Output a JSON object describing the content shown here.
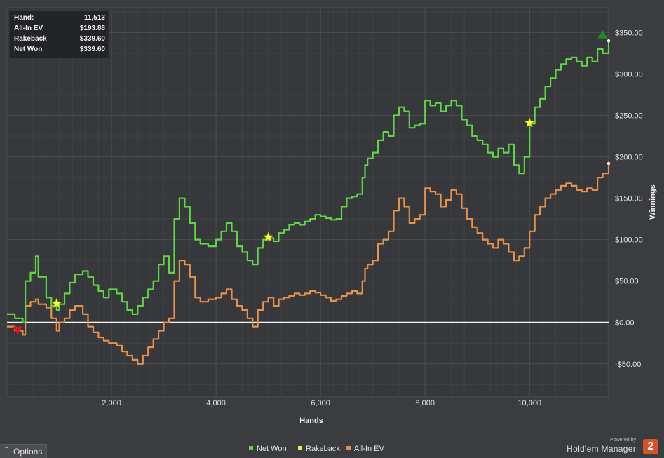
{
  "summary": {
    "rows": [
      {
        "label": "Hand:",
        "value": "11,513"
      },
      {
        "label": "All-In EV",
        "value": "$193.88"
      },
      {
        "label": "Rakeback",
        "value": "$339.60"
      },
      {
        "label": "Net Won",
        "value": "$339.60"
      }
    ]
  },
  "options": {
    "label": "Options",
    "icon": "chevron-up-icon"
  },
  "legend": [
    {
      "label": "Net Won",
      "color": "#5ed645"
    },
    {
      "label": "Rakeback",
      "color": "#ecec3a"
    },
    {
      "label": "All-In EV",
      "color": "#e8914a"
    }
  ],
  "branding": {
    "powered_by": "Powered by",
    "name": "Hold'em Manager",
    "logo_text": "2"
  },
  "chart_data": {
    "type": "line",
    "xlabel": "Hands",
    "ylabel": "Winnings",
    "xlim": [
      0,
      11513
    ],
    "ylim": [
      -90,
      380
    ],
    "x_ticks": [
      2000,
      4000,
      6000,
      8000,
      10000
    ],
    "x_tick_labels": [
      "2,000",
      "4,000",
      "6,000",
      "8,000",
      "10,000"
    ],
    "y_ticks": [
      -50,
      0,
      50,
      100,
      150,
      200,
      250,
      300,
      350
    ],
    "y_tick_labels": [
      "-$50.00",
      "$0.00",
      "$50.00",
      "$100.00",
      "$150.00",
      "$200.00",
      "$250.00",
      "$300.00",
      "$350.00"
    ],
    "grid": true,
    "y_axis_side": "right",
    "series": [
      {
        "name": "Net Won",
        "color": "#5ed645",
        "x": [
          0,
          150,
          300,
          350,
          450,
          550,
          600,
          750,
          850,
          950,
          1000,
          1100,
          1200,
          1300,
          1450,
          1550,
          1650,
          1750,
          1850,
          1950,
          2100,
          2200,
          2300,
          2400,
          2500,
          2600,
          2700,
          2800,
          2900,
          3000,
          3100,
          3200,
          3300,
          3400,
          3500,
          3600,
          3700,
          3850,
          4000,
          4100,
          4200,
          4300,
          4400,
          4500,
          4600,
          4700,
          4800,
          4900,
          5000,
          5100,
          5200,
          5300,
          5400,
          5500,
          5600,
          5700,
          5800,
          5900,
          6000,
          6100,
          6200,
          6300,
          6400,
          6500,
          6600,
          6700,
          6800,
          6850,
          6900,
          7000,
          7100,
          7200,
          7300,
          7400,
          7500,
          7600,
          7700,
          7800,
          7900,
          8000,
          8100,
          8200,
          8300,
          8400,
          8500,
          8600,
          8700,
          8800,
          8900,
          9000,
          9100,
          9200,
          9300,
          9400,
          9500,
          9600,
          9700,
          9800,
          9900,
          10000,
          10100,
          10200,
          10300,
          10400,
          10500,
          10600,
          10700,
          10800,
          10900,
          11000,
          11100,
          11200,
          11300,
          11400,
          11513
        ],
        "y": [
          10,
          5,
          0,
          50,
          60,
          80,
          55,
          30,
          20,
          15,
          22,
          35,
          48,
          58,
          62,
          55,
          45,
          38,
          30,
          40,
          35,
          25,
          15,
          10,
          20,
          30,
          40,
          50,
          70,
          80,
          60,
          125,
          150,
          140,
          120,
          100,
          95,
          92,
          100,
          110,
          120,
          110,
          92,
          85,
          75,
          70,
          90,
          100,
          102,
          98,
          108,
          112,
          118,
          120,
          118,
          122,
          125,
          130,
          128,
          126,
          124,
          125,
          140,
          150,
          152,
          155,
          175,
          190,
          198,
          205,
          220,
          230,
          225,
          250,
          260,
          255,
          235,
          238,
          240,
          268,
          262,
          265,
          255,
          262,
          268,
          262,
          245,
          238,
          225,
          220,
          215,
          205,
          200,
          210,
          205,
          215,
          190,
          180,
          200,
          240,
          260,
          270,
          285,
          295,
          305,
          312,
          318,
          320,
          315,
          310,
          320,
          315,
          330,
          325,
          340
        ]
      },
      {
        "name": "All-In EV",
        "color": "#e8914a",
        "x": [
          0,
          150,
          300,
          350,
          450,
          550,
          600,
          750,
          850,
          950,
          1000,
          1100,
          1200,
          1300,
          1450,
          1550,
          1650,
          1750,
          1850,
          1950,
          2100,
          2200,
          2300,
          2400,
          2500,
          2600,
          2700,
          2800,
          2900,
          3000,
          3100,
          3200,
          3300,
          3400,
          3500,
          3600,
          3700,
          3850,
          4000,
          4100,
          4200,
          4300,
          4400,
          4500,
          4600,
          4700,
          4800,
          4900,
          5000,
          5100,
          5200,
          5300,
          5400,
          5500,
          5600,
          5700,
          5800,
          5900,
          6000,
          6100,
          6200,
          6300,
          6400,
          6500,
          6600,
          6700,
          6800,
          6850,
          6900,
          7000,
          7100,
          7200,
          7300,
          7400,
          7500,
          7600,
          7700,
          7800,
          7900,
          8000,
          8100,
          8200,
          8300,
          8400,
          8500,
          8600,
          8700,
          8800,
          8900,
          9000,
          9100,
          9200,
          9300,
          9400,
          9500,
          9600,
          9700,
          9800,
          9900,
          10000,
          10100,
          10200,
          10300,
          10400,
          10500,
          10600,
          10700,
          10800,
          10900,
          11000,
          11100,
          11200,
          11300,
          11400,
          11513
        ],
        "y": [
          -5,
          -10,
          -15,
          20,
          25,
          28,
          22,
          18,
          5,
          -10,
          0,
          5,
          15,
          20,
          10,
          -5,
          -12,
          -18,
          -22,
          -25,
          -28,
          -35,
          -40,
          -45,
          -50,
          -40,
          -30,
          -20,
          -10,
          0,
          5,
          50,
          75,
          70,
          55,
          30,
          25,
          28,
          30,
          35,
          40,
          28,
          20,
          15,
          5,
          -5,
          15,
          25,
          30,
          20,
          28,
          30,
          32,
          35,
          33,
          35,
          38,
          36,
          33,
          30,
          26,
          28,
          32,
          35,
          38,
          35,
          50,
          65,
          70,
          75,
          95,
          100,
          110,
          135,
          150,
          140,
          120,
          125,
          130,
          162,
          158,
          155,
          140,
          148,
          160,
          155,
          138,
          125,
          115,
          108,
          100,
          95,
          90,
          100,
          95,
          85,
          75,
          80,
          90,
          110,
          130,
          140,
          150,
          155,
          160,
          165,
          168,
          165,
          160,
          158,
          162,
          160,
          175,
          180,
          192
        ]
      }
    ],
    "markers": [
      {
        "type": "rakeback-star",
        "x": 950,
        "y": 23,
        "color": "#ffff33"
      },
      {
        "type": "rakeback-star",
        "x": 5000,
        "y": 103,
        "color": "#ffff33"
      },
      {
        "type": "rakeback-star",
        "x": 10000,
        "y": 241,
        "color": "#ffff33"
      },
      {
        "type": "low-triangle",
        "x": 200,
        "y": -10,
        "color": "#d11a1a"
      },
      {
        "type": "high-triangle",
        "x": 11400,
        "y": 348,
        "color": "#1f8a1f"
      }
    ]
  }
}
